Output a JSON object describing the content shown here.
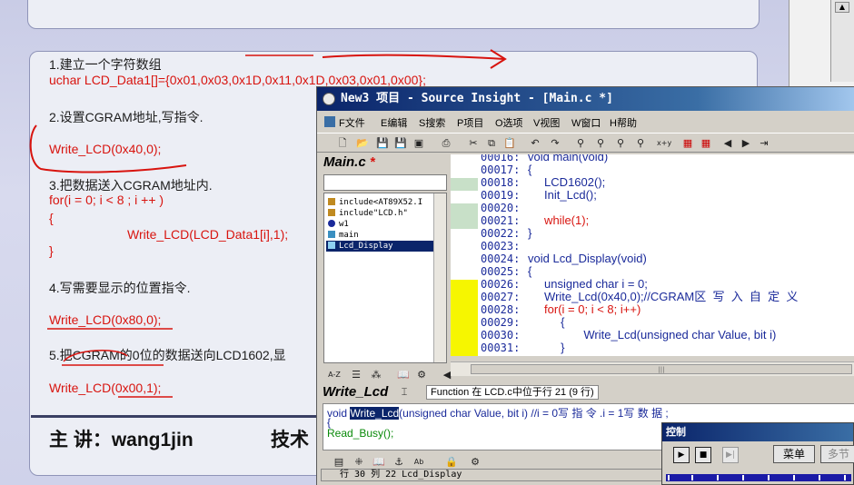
{
  "slide": {
    "steps": [
      {
        "heading": "1.建立一个字符数组",
        "code": "uchar LCD_Data1[]={0x01,0x03,0x1D,0x11,0x1D,0x03,0x01,0x00};"
      },
      {
        "heading": "2.设置CGRAM地址,写指令.",
        "code": "Write_LCD(0x40,0);"
      },
      {
        "heading": "3.把数据送入CGRAM地址内.",
        "loop_line": "for(i = 0; i < 8 ; i ++ )",
        "open_brace": "{",
        "loop_body": "Write_LCD(LCD_Data1[i],1);",
        "close_brace": "}"
      },
      {
        "heading": "4.写需要显示的位置指令.",
        "code": "Write_LCD(0x80,0);"
      },
      {
        "heading": "5.把CGRAM的0位的数据送向LCD1602,显",
        "code": "Write_LCD(0x00,1);"
      }
    ],
    "footer": {
      "presenter": "主  讲：wang1jin",
      "tech": "技术"
    }
  },
  "source_insight": {
    "title": "New3 项目 - Source Insight - [Main.c *]",
    "menu": [
      "F文件",
      "E编辑",
      "S搜索",
      "P项目",
      "O选项",
      "V视图",
      "W窗口",
      "H帮助"
    ],
    "file_name": "Main.c",
    "modified_mark": " *",
    "symbols": [
      {
        "label": "include<AT89X52.I",
        "icon": "include-icon"
      },
      {
        "label": "include\"LCD.h\"",
        "icon": "include-icon"
      },
      {
        "label": "w1",
        "icon": "variable-icon"
      },
      {
        "label": "main",
        "icon": "function-icon"
      },
      {
        "label": "Lcd_Display",
        "icon": "function-icon"
      }
    ],
    "selected_symbol": "Lcd_Display",
    "code_lines": [
      {
        "num": "00016:",
        "text": "void main(void)",
        "red": false
      },
      {
        "num": "00017:",
        "text": "{",
        "red": false
      },
      {
        "num": "00018:",
        "text": "     LCD1602();",
        "red": false
      },
      {
        "num": "00019:",
        "text": "     Init_Lcd();",
        "red": false
      },
      {
        "num": "00020:",
        "text": "",
        "red": false
      },
      {
        "num": "00021:",
        "text": "     while(1);",
        "red": true
      },
      {
        "num": "00022:",
        "text": "}",
        "red": false
      },
      {
        "num": "00023:",
        "text": "",
        "red": false
      },
      {
        "num": "00024:",
        "text": "void Lcd_Display(void)",
        "red": false
      },
      {
        "num": "00025:",
        "text": "{",
        "red": false
      },
      {
        "num": "00026:",
        "text": "     unsigned char i = 0;",
        "red": false
      },
      {
        "num": "00027:",
        "text": "     Write_Lcd(0x40,0);//CGRAM区  写  入  自  定  义",
        "red": false
      },
      {
        "num": "00028:",
        "text": "     for(i = 0; i < 8; i++)",
        "red": true
      },
      {
        "num": "00029:",
        "text": "          {",
        "red": false
      },
      {
        "num": "00030:",
        "text": "                 Write_Lcd(unsigned char Value, bit i)",
        "red": false
      },
      {
        "num": "00031:",
        "text": "          }",
        "red": false
      }
    ],
    "context": {
      "name": "Write_Lcd",
      "info": "Function 在 LCD.c中位于行 21 (9 行)",
      "line1_pre": "void ",
      "line1_hl": "Write_Lcd",
      "line1_post": "(unsigned char Value, bit i)  //i = 0写  指  令  .i = 1写  数  据  ;",
      "line2": "{",
      "line3": "     Read_Busy();"
    },
    "status": "行 30  列 22   Lcd_Display"
  },
  "control": {
    "title": "控制",
    "menu_button": "菜单",
    "step_button": "多节"
  }
}
